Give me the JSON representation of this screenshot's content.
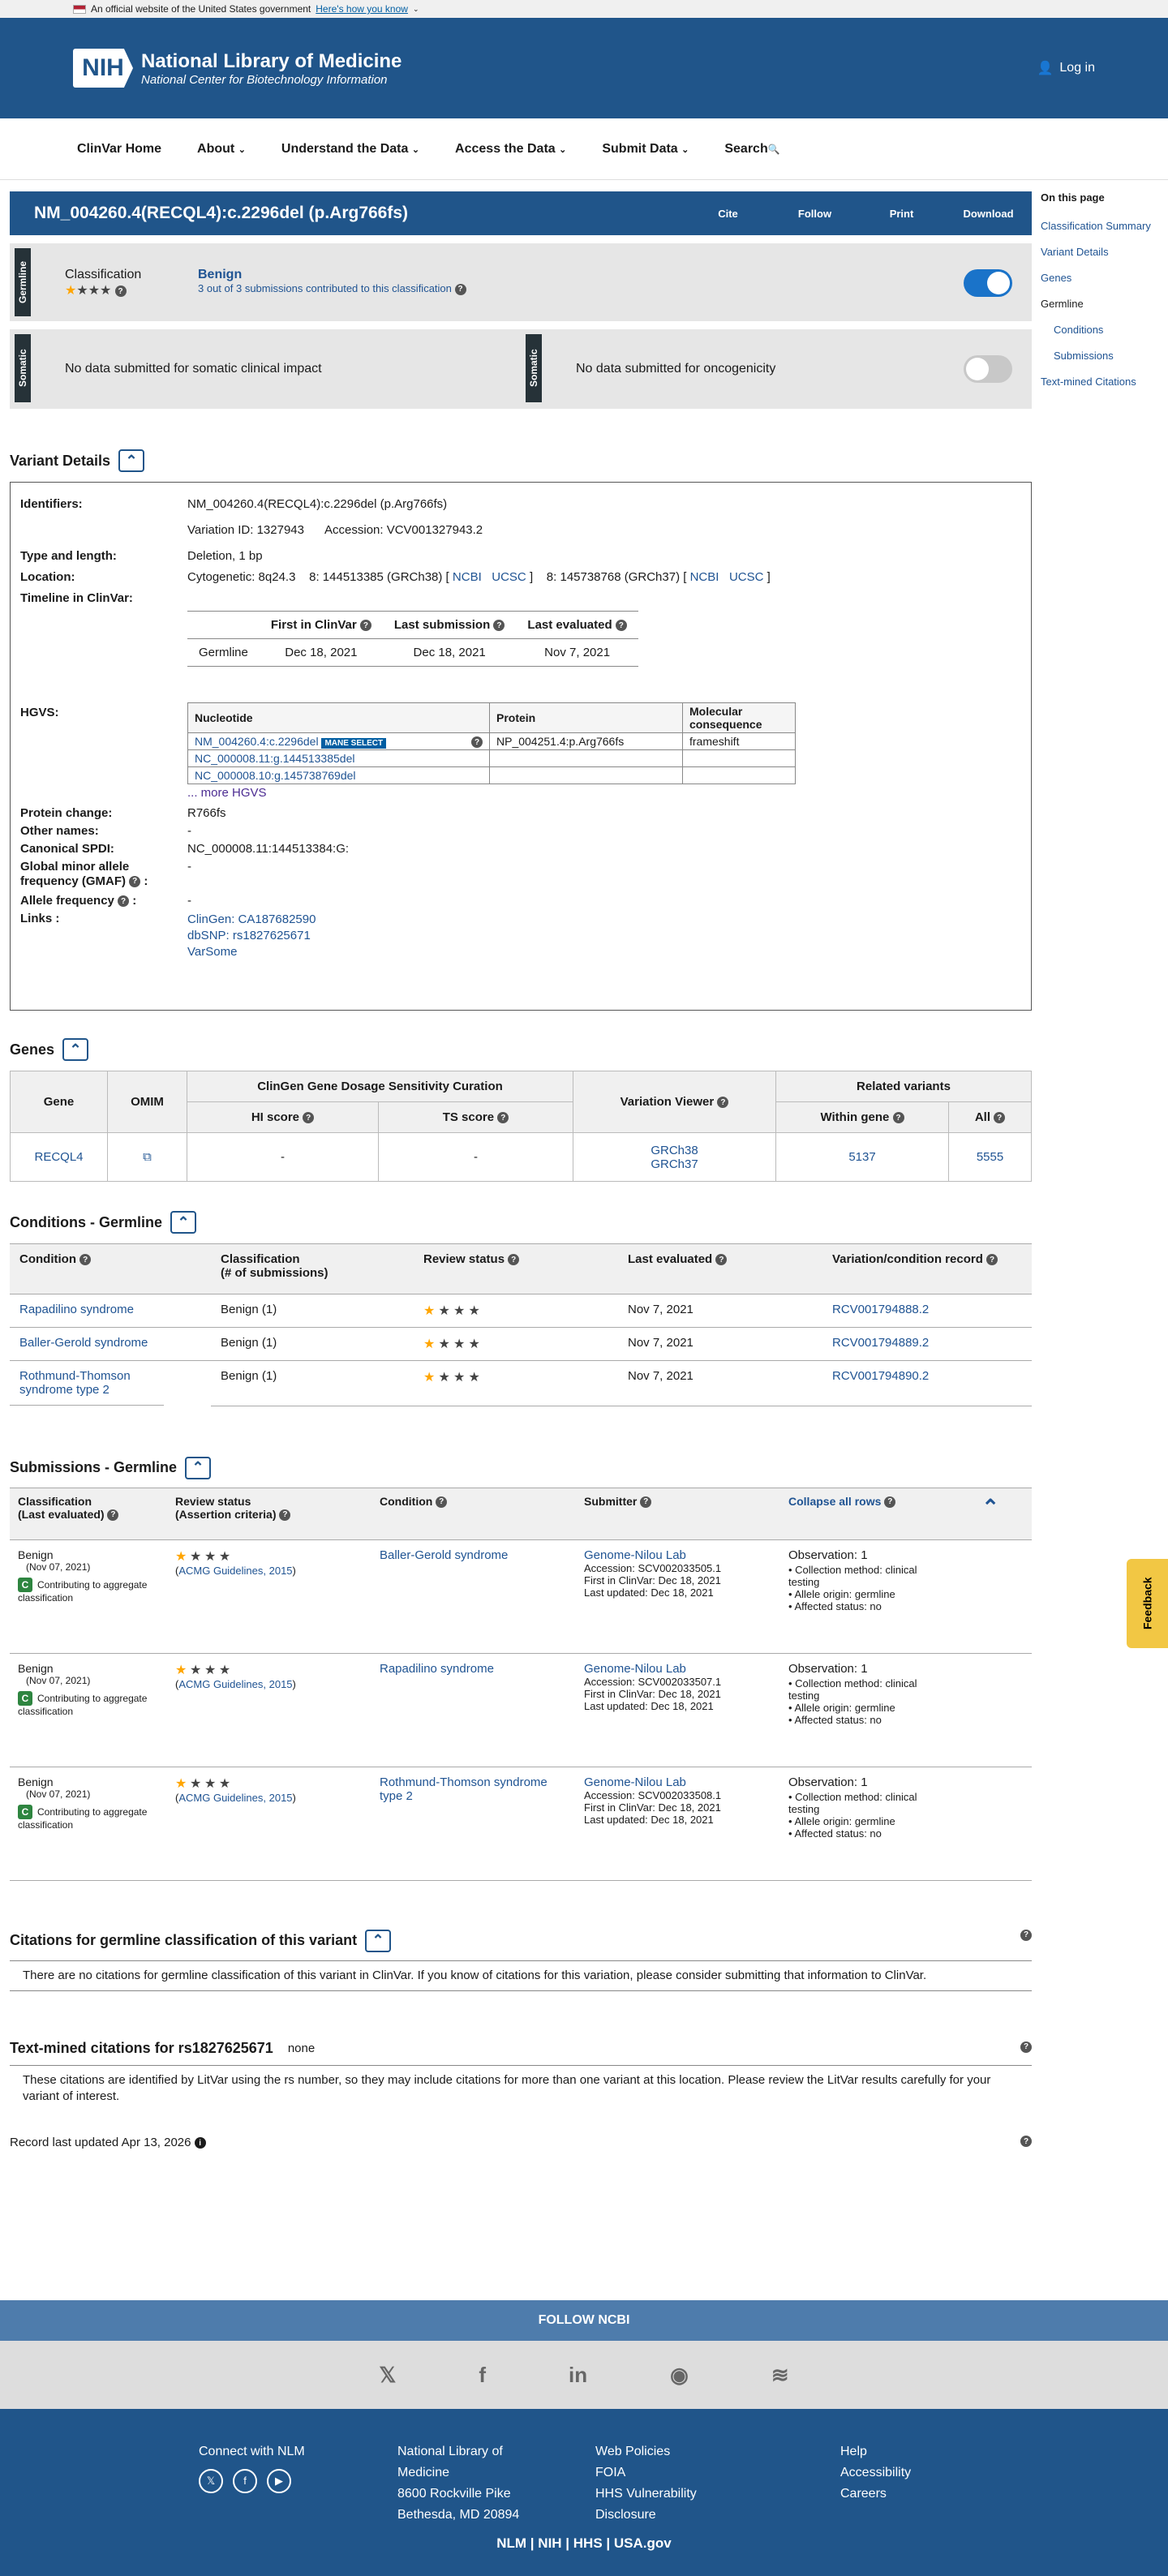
{
  "gov": {
    "text": "An official website of the United States government",
    "how": "Here's how you know"
  },
  "header": {
    "title": "National Library of Medicine",
    "subtitle": "National Center for Biotechnology Information",
    "login": "Log in",
    "logo": "NIH"
  },
  "nav": [
    "ClinVar Home",
    "About",
    "Understand the Data",
    "Access the Data",
    "Submit Data",
    "Search"
  ],
  "title": {
    "text": "NM_004260.4(RECQL4):c.2296del (p.Arg766fs)",
    "actions": [
      "Cite",
      "Follow",
      "Print",
      "Download"
    ]
  },
  "germline": {
    "tag": "Germline",
    "label": "Classification",
    "value": "Benign",
    "sub": "3 out of 3 submissions contributed to this classification",
    "stars": 1
  },
  "somatic": {
    "tag": "Somatic",
    "left": "No data submitted for somatic clinical impact",
    "right": "No data submitted for oncogenicity"
  },
  "toc": {
    "title": "On this page",
    "items": [
      "Classification Summary",
      "Variant Details",
      "Genes",
      "Germline",
      "Conditions",
      "Submissions",
      "Text-mined Citations"
    ]
  },
  "variant": {
    "heading": "Variant Details",
    "identifiers_label": "Identifiers:",
    "identifier": "NM_004260.4(RECQL4):c.2296del (p.Arg766fs)",
    "variation_id": "Variation ID: 1327943",
    "accession": "Accession: VCV001327943.2",
    "type_label": "Type and length:",
    "type": "Deletion, 1 bp",
    "location_label": "Location:",
    "cyto": "Cytogenetic: 8q24.3",
    "grch38": "8: 144513385 (GRCh38) [",
    "grch37": "8: 145738768 (GRCh37) [",
    "ncbi": "NCBI",
    "ucsc": "UCSC",
    "close": "]",
    "timeline_label": "Timeline in ClinVar:",
    "tl_headers": [
      "First in ClinVar",
      "Last submission",
      "Last evaluated"
    ],
    "tl_row": [
      "Germline",
      "Dec 18, 2021",
      "Dec 18, 2021",
      "Nov 7, 2021"
    ],
    "hgvs_label": "HGVS:",
    "hgvs_headers": [
      "Nucleotide",
      "Protein",
      "Molecular consequence"
    ],
    "hgvs_rows": [
      [
        "NM_004260.4:c.2296del",
        "NP_004251.4:p.Arg766fs",
        "frameshift"
      ],
      [
        "NC_000008.11:g.144513385del",
        "",
        ""
      ],
      [
        "NC_000008.10:g.145738769del",
        "",
        ""
      ]
    ],
    "mane": "MANE SELECT",
    "more": "... more HGVS",
    "protein_label": "Protein change:",
    "protein": "R766fs",
    "other_label": "Other names:",
    "other": "-",
    "spdi_label": "Canonical SPDI:",
    "spdi": "NC_000008.11:144513384:G:",
    "gmaf_label": "Global minor allele frequency (GMAF)",
    "gmaf": "-",
    "af_label": "Allele frequency",
    "af": "-",
    "links_label": "Links :",
    "links": [
      "ClinGen: CA187682590",
      "dbSNP: rs1827625671",
      "VarSome"
    ]
  },
  "genes": {
    "heading": "Genes",
    "h_gene": "Gene",
    "h_omim": "OMIM",
    "h_clingen": "ClinGen Gene Dosage Sensitivity Curation",
    "h_hi": "HI score",
    "h_ts": "TS score",
    "h_viewer": "Variation Viewer",
    "h_related": "Related variants",
    "h_within": "Within gene",
    "h_all": "All",
    "gene": "RECQL4",
    "hi": "-",
    "ts": "-",
    "v38": "GRCh38",
    "v37": "GRCh37",
    "within": "5137",
    "all": "5555"
  },
  "conditions": {
    "heading": "Conditions - Germline",
    "headers": [
      "Condition",
      "Classification\n(# of submissions)",
      "Review status",
      "Last evaluated",
      "Variation/condition record"
    ],
    "rows": [
      {
        "cond": "Rapadilino syndrome",
        "cls": "Benign (1)",
        "date": "Nov 7, 2021",
        "rec": "RCV001794888.2"
      },
      {
        "cond": "Baller-Gerold syndrome",
        "cls": "Benign (1)",
        "date": "Nov 7, 2021",
        "rec": "RCV001794889.2"
      },
      {
        "cond": "Rothmund-Thomson syndrome type 2",
        "cls": "Benign (1)",
        "date": "Nov 7, 2021",
        "rec": "RCV001794890.2"
      }
    ]
  },
  "submissions": {
    "heading": "Submissions - Germline",
    "h_cls": "Classification\n(Last evaluated)",
    "h_rev": "Review status\n(Assertion criteria)",
    "h_cond": "Condition",
    "h_sub": "Submitter",
    "h_collapse": "Collapse all rows",
    "rows": [
      {
        "cls": "Benign",
        "date": "(Nov 07, 2021)",
        "contrib": "Contributing to aggregate classification",
        "crit": "ACMG Guidelines, 2015",
        "cond": "Baller-Gerold syndrome",
        "sub": "Genome-Nilou Lab",
        "acc": "Accession: SCV002033505.1",
        "first": "First in ClinVar: Dec 18, 2021",
        "last": "Last updated: Dec 18, 2021",
        "obs": "Observation: 1",
        "b1": "Collection method: clinical testing",
        "b2": "Allele origin: germline",
        "b3": "Affected status: no"
      },
      {
        "cls": "Benign",
        "date": "(Nov 07, 2021)",
        "contrib": "Contributing to aggregate classification",
        "crit": "ACMG Guidelines, 2015",
        "cond": "Rapadilino syndrome",
        "sub": "Genome-Nilou Lab",
        "acc": "Accession: SCV002033507.1",
        "first": "First in ClinVar: Dec 18, 2021",
        "last": "Last updated: Dec 18, 2021",
        "obs": "Observation: 1",
        "b1": "Collection method: clinical testing",
        "b2": "Allele origin: germline",
        "b3": "Affected status: no"
      },
      {
        "cls": "Benign",
        "date": "(Nov 07, 2021)",
        "contrib": "Contributing to aggregate classification",
        "crit": "ACMG Guidelines, 2015",
        "cond": "Rothmund-Thomson syndrome type 2",
        "sub": "Genome-Nilou Lab",
        "acc": "Accession: SCV002033508.1",
        "first": "First in ClinVar: Dec 18, 2021",
        "last": "Last updated: Dec 18, 2021",
        "obs": "Observation: 1",
        "b1": "Collection method: clinical testing",
        "b2": "Allele origin: germline",
        "b3": "Affected status: no"
      }
    ]
  },
  "citations": {
    "heading": "Citations for germline classification of this variant",
    "text": "There are no citations for germline classification of this variant in ClinVar. If you know of citations for this variation, please consider submitting that information to ClinVar."
  },
  "textmined": {
    "heading": "Text-mined citations for rs1827625671",
    "none": "none",
    "text": "These citations are identified by LitVar using the rs number, so they may include citations for more than one variant at this location. Please review the LitVar results carefully for your variant of interest."
  },
  "record": "Record last updated Apr 13, 2026",
  "feedback": "Feedback",
  "follow": "FOLLOW NCBI",
  "footer": {
    "connect": "Connect with NLM",
    "addr": [
      "National Library of",
      "Medicine",
      "8600 Rockville Pike",
      "Bethesda, MD 20894"
    ],
    "col3": [
      "Web Policies",
      "FOIA",
      "HHS Vulnerability",
      "Disclosure"
    ],
    "col4": [
      "Help",
      "Accessibility",
      "Careers"
    ],
    "bottom": "NLM | NIH | HHS | USA.gov"
  },
  "colors": {
    "brand": "#20558a",
    "toggle_on": "#1a73c9",
    "toggle_off": "#c8c8c8",
    "star": "#ffa500"
  }
}
